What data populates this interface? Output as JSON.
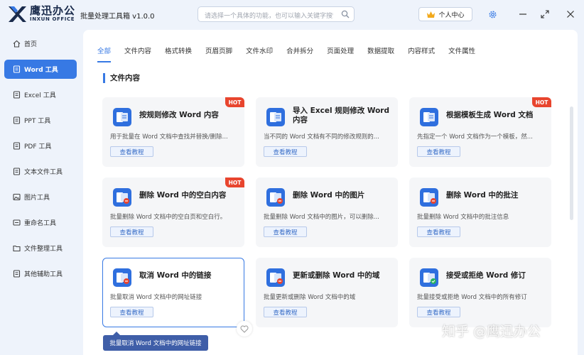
{
  "brand": {
    "name_cn": "鹰迅办公",
    "name_en": "INXUN OFFICE",
    "primary": "#3779e4",
    "hot": "#e8452e"
  },
  "app_title": "批量处理工具箱 v1.0.0",
  "search": {
    "placeholder": "请选择一个具体的功能，也可以输入关键字搜索!"
  },
  "user_center": {
    "label": "个人中心",
    "icon": "crown-icon"
  },
  "sidebar": {
    "items": [
      {
        "label": "首页",
        "icon": "home-icon",
        "active": false
      },
      {
        "label": "Word 工具",
        "icon": "word-doc-icon",
        "active": true
      },
      {
        "label": "Excel 工具",
        "icon": "excel-icon",
        "active": false
      },
      {
        "label": "PPT 工具",
        "icon": "ppt-icon",
        "active": false
      },
      {
        "label": "PDF 工具",
        "icon": "pdf-icon",
        "active": false
      },
      {
        "label": "文本文件工具",
        "icon": "text-file-icon",
        "active": false
      },
      {
        "label": "图片工具",
        "icon": "image-icon",
        "active": false
      },
      {
        "label": "重命名工具",
        "icon": "rename-icon",
        "active": false
      },
      {
        "label": "文件整理工具",
        "icon": "folder-icon",
        "active": false
      },
      {
        "label": "其他辅助工具",
        "icon": "tools-icon",
        "active": false
      }
    ]
  },
  "tabs": [
    "全部",
    "文件内容",
    "格式转换",
    "页眉页脚",
    "文件水印",
    "合并拆分",
    "页面处理",
    "数据提取",
    "内容样式",
    "文件属性"
  ],
  "section_title": "文件内容",
  "hot_label": "HOT",
  "button_label": "查看教程",
  "cards": [
    {
      "title": "按规则修改 Word 内容",
      "desc": "用于批量在 Word 文档中查找并替换/删除...",
      "icon": "word-edit-icon",
      "hot": true
    },
    {
      "title": "导入 Excel 规则修改 Word 内容",
      "desc": "当不同的 Word 文档有不同的修改规则的...",
      "icon": "excel-word-icon",
      "hot": false
    },
    {
      "title": "根据模板生成 Word 文档",
      "desc": "先指定一个 Word 文档作为一个模板，然...",
      "icon": "word-template-icon",
      "hot": true
    },
    {
      "title": "删除 Word 中的空白内容",
      "desc": "批量删除 Word 文档中的空白页和空白行。",
      "icon": "word-delete-icon",
      "hot": true
    },
    {
      "title": "删除 Word 中的图片",
      "desc": "批量删除 Word 文档中的图片，可以删除...",
      "icon": "word-delete-icon",
      "hot": false
    },
    {
      "title": "删除 Word 中的批注",
      "desc": "批量删除 Word 文档中的批注信息",
      "icon": "word-delete-icon",
      "hot": false
    },
    {
      "title": "取消 Word 中的链接",
      "desc": "批量取消 Word 文档中的网址链接",
      "icon": "word-delete-icon",
      "hot": false
    },
    {
      "title": "更新或删除 Word 中的域",
      "desc": "批量更新或删除 Word 文档中的域",
      "icon": "word-delete-icon",
      "hot": false
    },
    {
      "title": "接受或拒绝 Word 修订",
      "desc": "批量接受或拒绝 Word 文档中的所有修订",
      "icon": "word-accept-icon",
      "hot": false
    }
  ],
  "tooltip": "批量取消 Word 文档中的网址链接",
  "watermark": "知乎 @鹰迅办公"
}
